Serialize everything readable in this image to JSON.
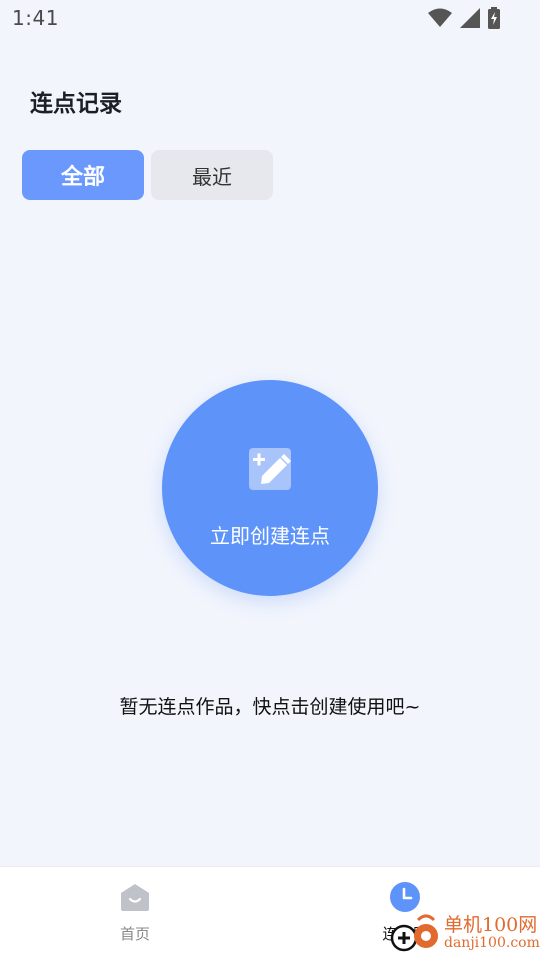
{
  "status_bar": {
    "time": "1:41",
    "icons": [
      "wifi-icon",
      "signal-icon",
      "battery-charging-icon"
    ]
  },
  "header": {
    "title": "连点记录"
  },
  "tabs": [
    {
      "label": "全部",
      "selected": true
    },
    {
      "label": "最近",
      "selected": false
    }
  ],
  "create_button": {
    "label": "立即创建连点",
    "icon": "edit-add-icon",
    "color": "#5E93FA"
  },
  "empty_state": {
    "message": "暂无连点作品，快点击创建使用吧~"
  },
  "bottom_nav": {
    "items": [
      {
        "label": "首页",
        "icon": "home-icon",
        "active": false
      },
      {
        "label": "连点器",
        "icon": "clock-icon",
        "active": true
      }
    ]
  },
  "watermark": {
    "cn": "单机100网",
    "en": "danji100.com"
  },
  "colors": {
    "accent": "#6A98FD",
    "background": "#F2F5FC",
    "tab_inactive": "#E6E8ED"
  }
}
